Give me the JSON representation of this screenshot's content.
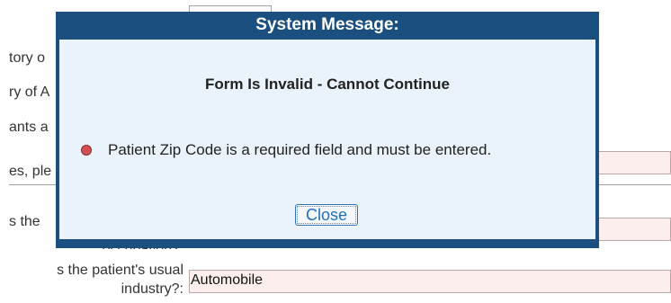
{
  "background": {
    "labels": [
      "tory o",
      "ry of A",
      "ants a",
      "es, ple",
      "s the",
      "occupation?",
      "s the patient's usual",
      "industry?:"
    ],
    "industry_value": "Automobile"
  },
  "dialog": {
    "title": "System Message:",
    "heading": "Form Is Invalid - Cannot Continue",
    "message": "Patient Zip Code is a required field and must be entered.",
    "close_label": "Close"
  },
  "colors": {
    "dialog_frame": "#1b4f7f",
    "dialog_body": "#eaf3fb",
    "error_dot": "#d05055",
    "invalid_field": "#fdeeee",
    "close_text": "#1f6fb8"
  }
}
